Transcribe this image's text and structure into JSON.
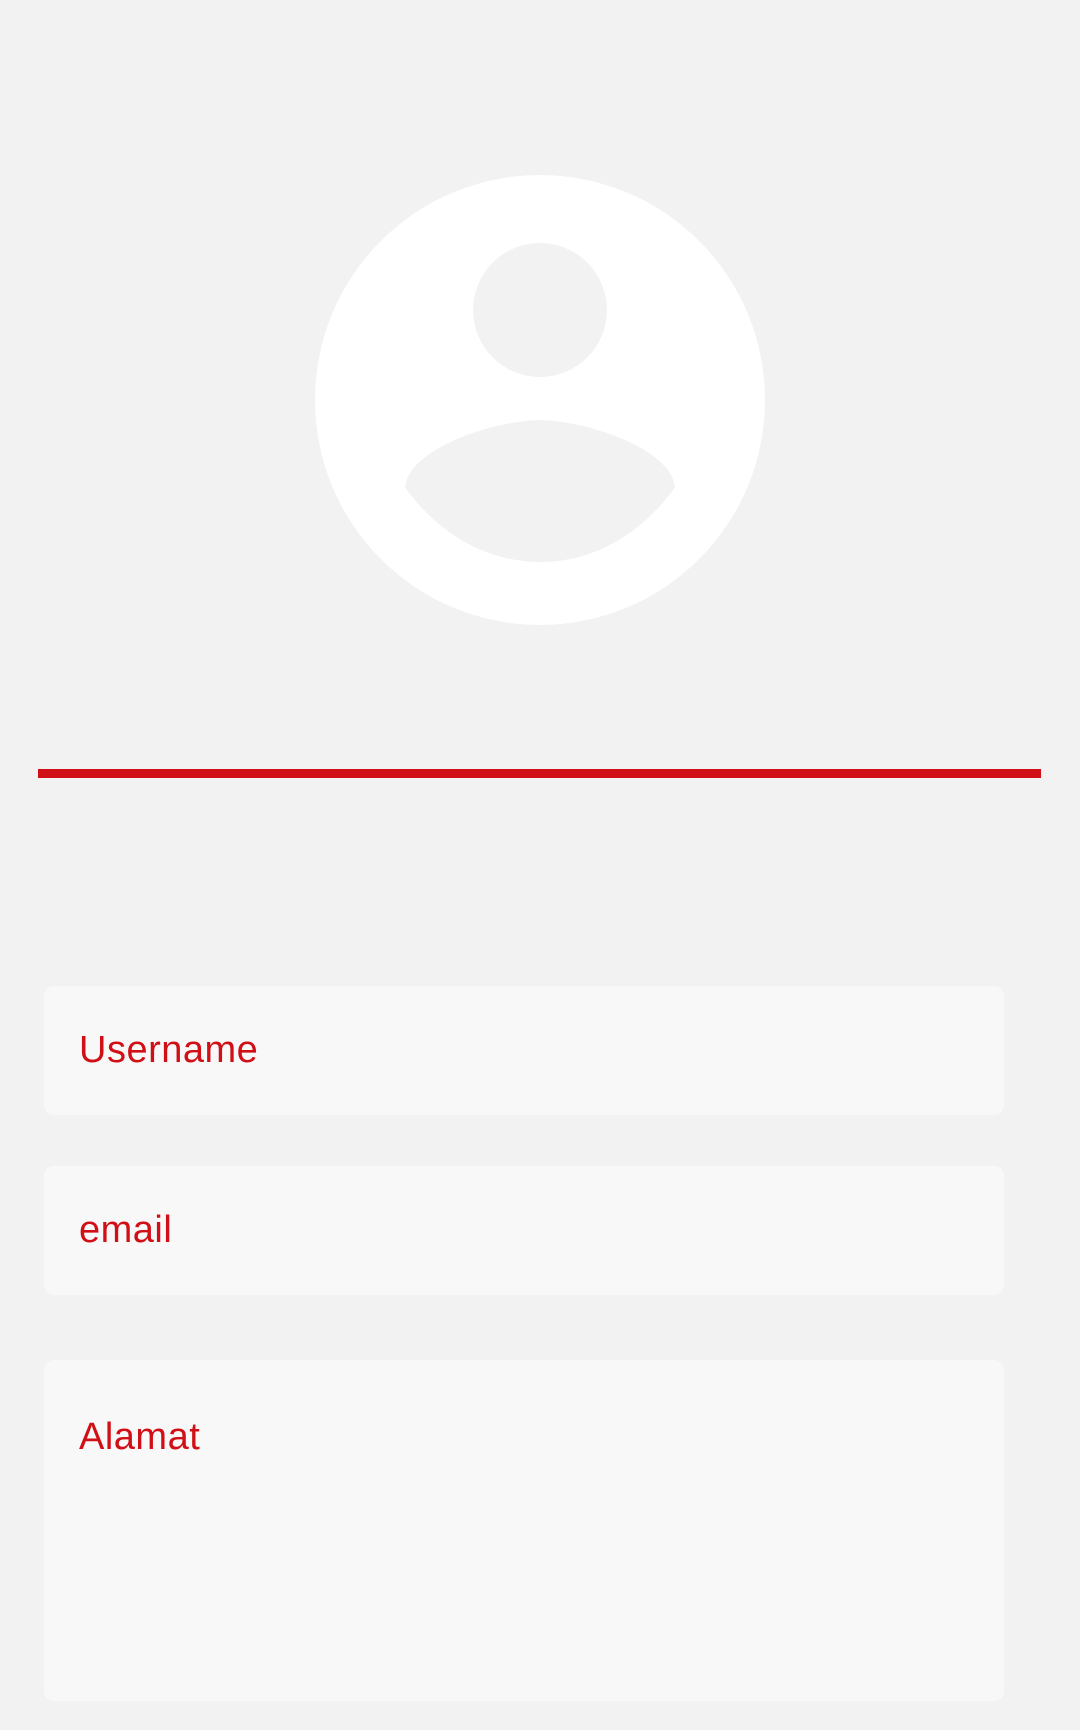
{
  "profile": {
    "avatar_icon": "user-circle-icon"
  },
  "colors": {
    "accent": "#d10f16",
    "background": "#f2f2f2",
    "field_background": "#f8f8f8",
    "avatar": "#ffffff"
  },
  "form": {
    "username": {
      "value": "",
      "placeholder": "Username"
    },
    "email": {
      "value": "",
      "placeholder": "email"
    },
    "address": {
      "value": "",
      "placeholder": "Alamat"
    }
  }
}
